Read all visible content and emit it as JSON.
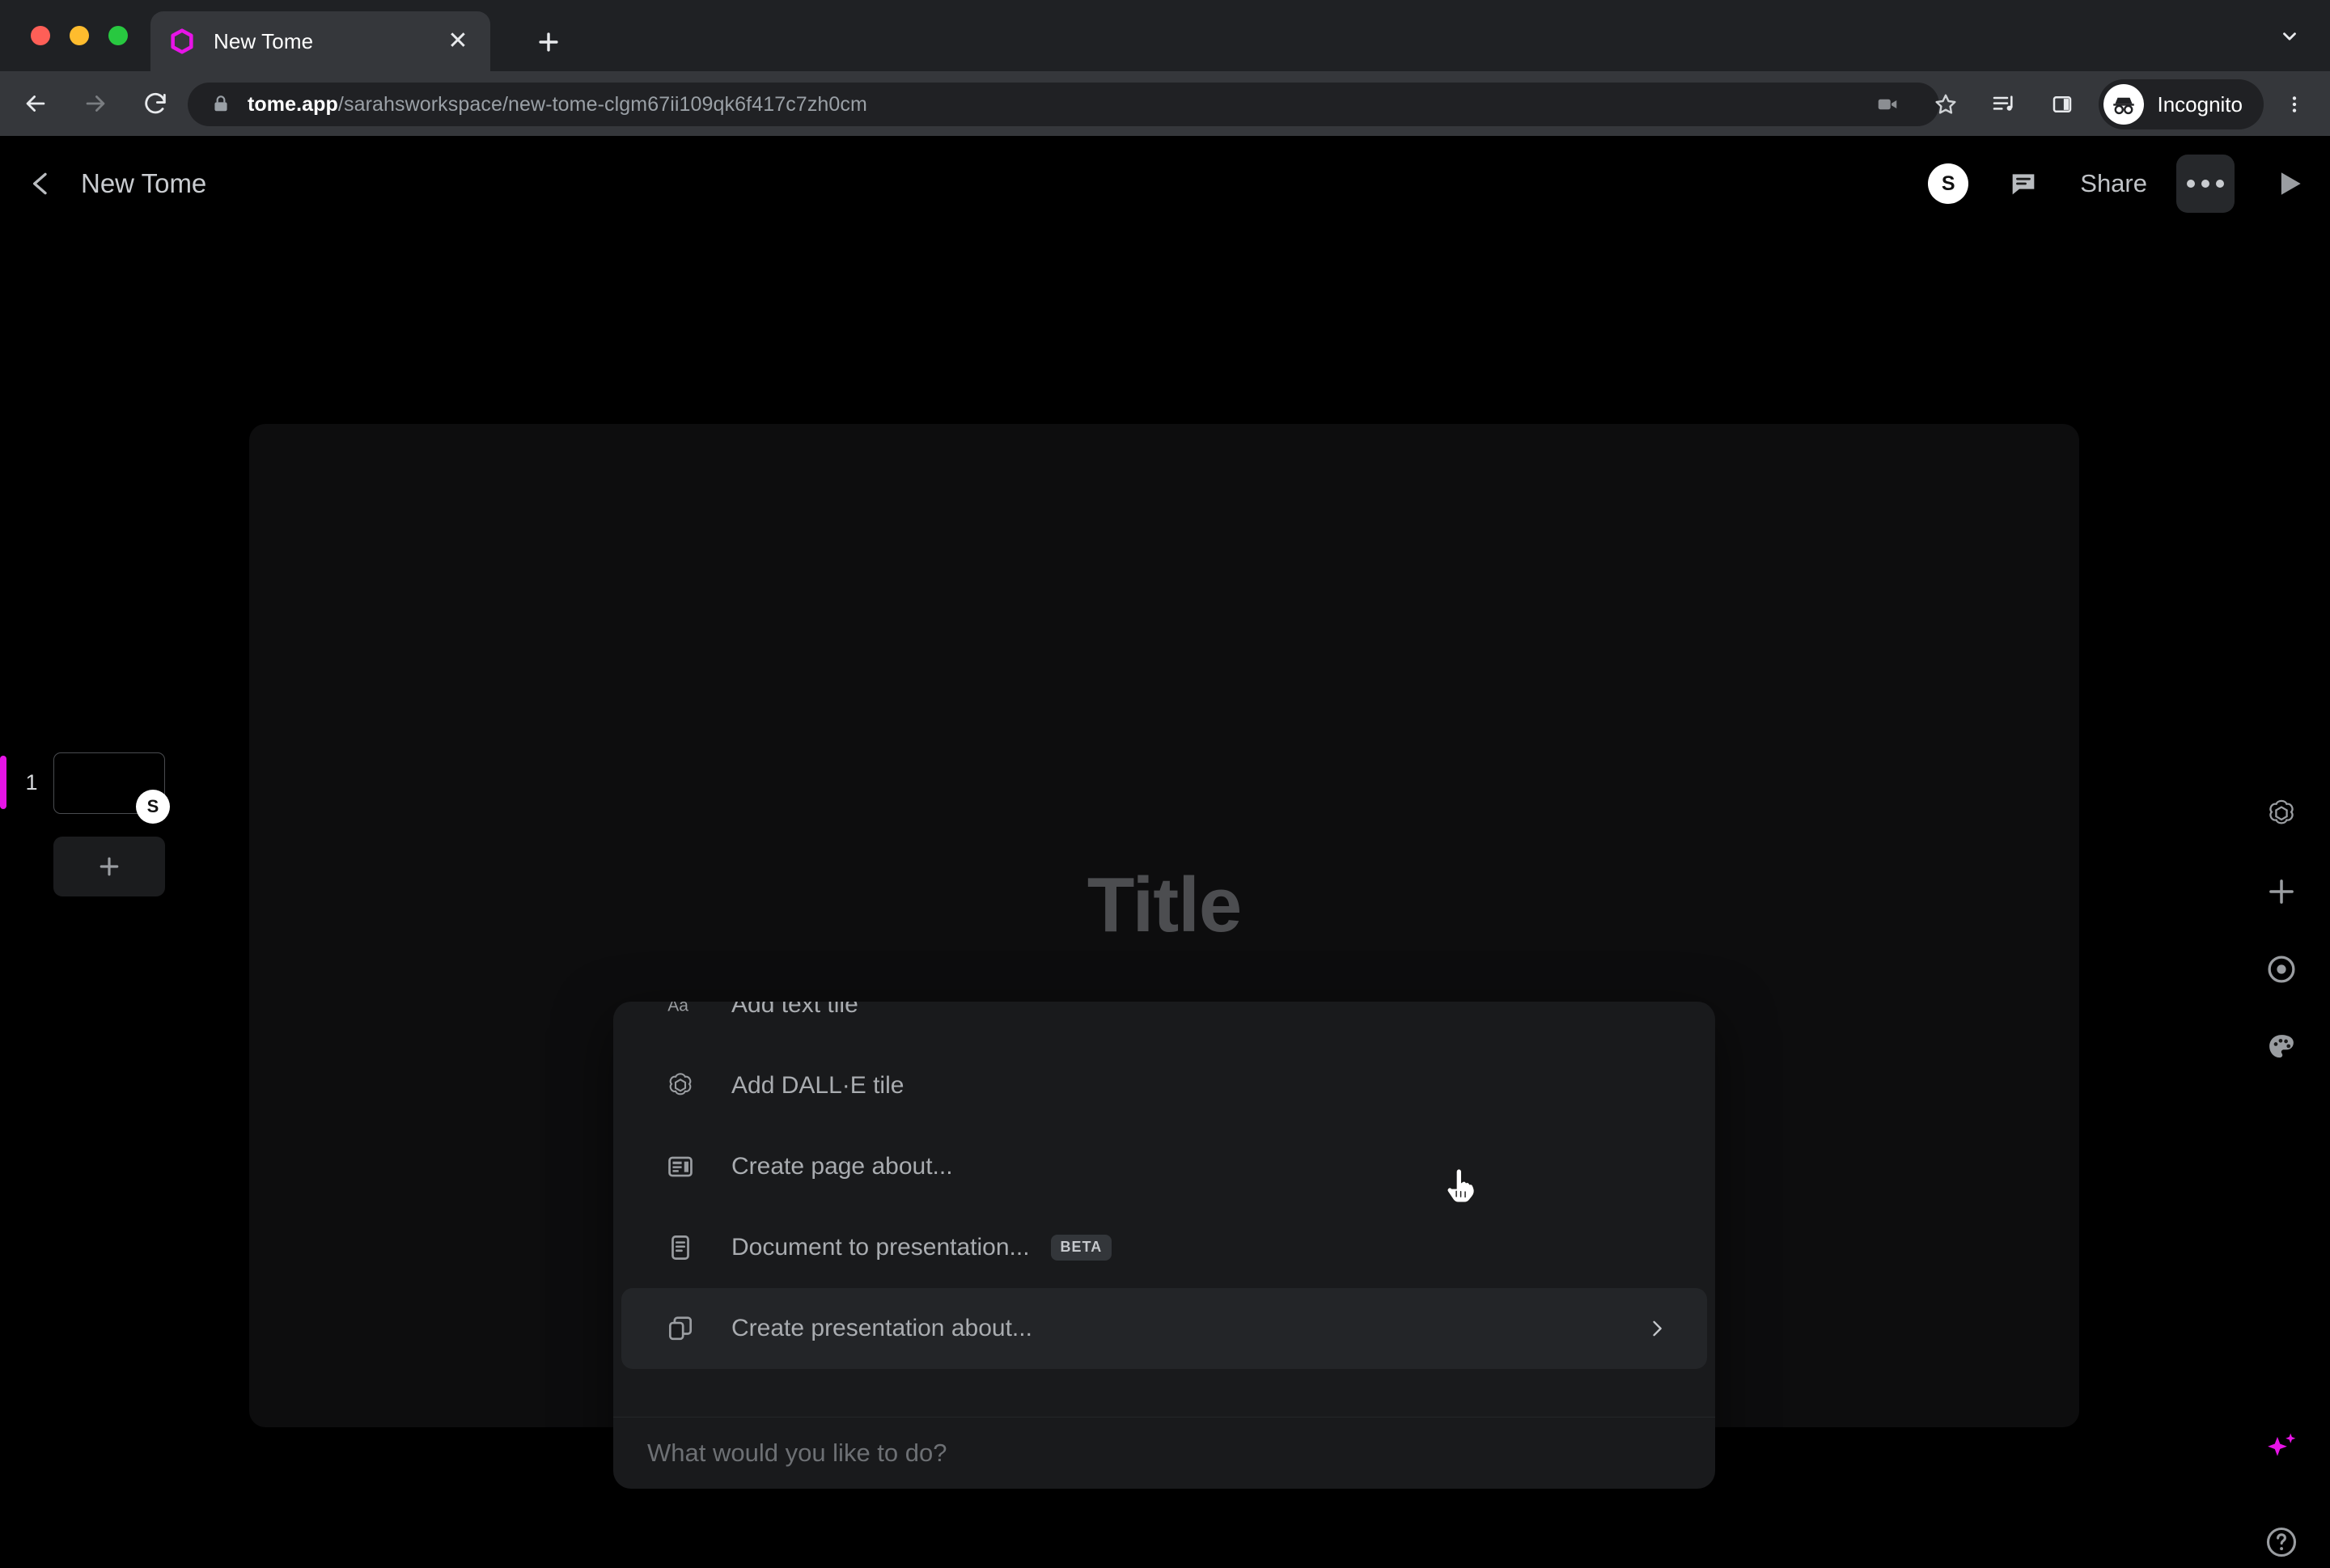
{
  "browser": {
    "window_controls": [
      "close",
      "minimize",
      "maximize"
    ],
    "tab": {
      "title": "New Tome",
      "favicon": "tome-logo-icon",
      "close_label": "✕"
    },
    "new_tab_label": "+",
    "tabstrip_chevron": "chevron-down-icon",
    "nav": {
      "back": "back-arrow-icon",
      "forward": "forward-arrow-icon",
      "reload": "reload-icon"
    },
    "omnibox": {
      "lock": "lock-icon",
      "url_domain": "tome.app",
      "url_path": "/sarahsworkspace/new-tome-clgm67ii109qk6f417c7zh0cm",
      "url_full": "tome.app/sarahsworkspace/new-tome-clgm67ii109qk6f417c7zh0cm"
    },
    "actions": {
      "camera": "video-camera-icon",
      "bookmark": "star-icon",
      "media": "media-playlist-icon",
      "side_panel": "side-panel-icon",
      "incognito_label": "Incognito",
      "menu": "kebab-menu-icon"
    }
  },
  "app": {
    "header": {
      "back": "chevron-left-icon",
      "title": "New Tome",
      "avatar_initial": "S",
      "comments_icon": "comment-icon",
      "share_label": "Share",
      "more_label": "•••",
      "present_icon": "play-icon"
    },
    "rail": {
      "slide_number": "1",
      "slide_badge_initial": "S",
      "add_slide_label": "+"
    },
    "canvas": {
      "title_placeholder": "Title"
    },
    "tools": [
      {
        "name": "openai-icon"
      },
      {
        "name": "plus-icon"
      },
      {
        "name": "record-icon"
      },
      {
        "name": "palette-icon"
      },
      {
        "name": "sparkles-icon"
      },
      {
        "name": "help-icon"
      }
    ],
    "command_menu": {
      "items": [
        {
          "icon": "text-tile-icon",
          "label": "Add text tile",
          "badge": "",
          "chevron": false,
          "selected": false
        },
        {
          "icon": "openai-icon",
          "label": "Add DALL·E tile",
          "badge": "",
          "chevron": false,
          "selected": false
        },
        {
          "icon": "page-layout-icon",
          "label": "Create page about...",
          "badge": "",
          "chevron": false,
          "selected": false
        },
        {
          "icon": "document-icon",
          "label": "Document to presentation...",
          "badge": "BETA",
          "chevron": false,
          "selected": false
        },
        {
          "icon": "presentation-icon",
          "label": "Create presentation about...",
          "badge": "",
          "chevron": true,
          "selected": true
        }
      ],
      "input_placeholder": "What would you like to do?",
      "input_value": ""
    }
  },
  "colors": {
    "accent_magenta": "#e714e7",
    "chrome_tabstrip": "#1f2124",
    "chrome_toolbar": "#35373b",
    "omnibox_bg": "#202124",
    "app_bg": "#000000",
    "canvas_bg": "#0d0d0e",
    "menu_bg": "#191a1c",
    "menu_selected": "#232528"
  }
}
